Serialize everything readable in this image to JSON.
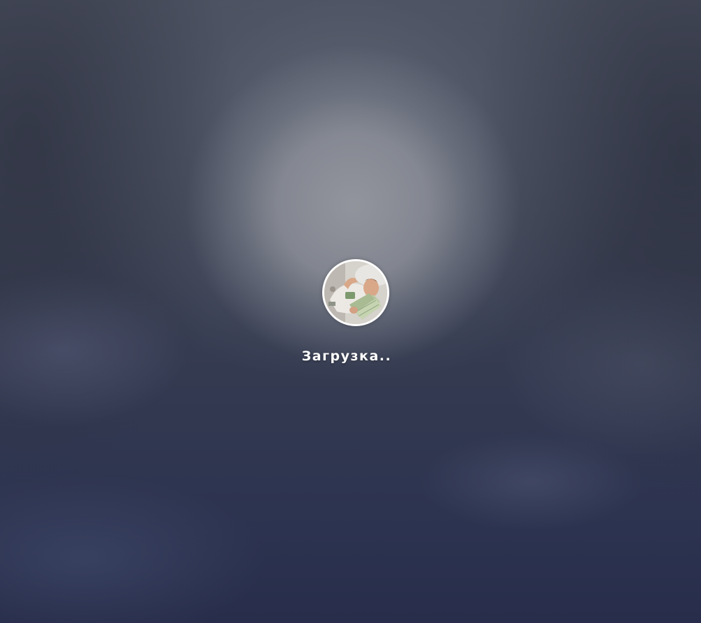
{
  "loading": {
    "text": "Загрузка.."
  },
  "avatar": {
    "icon": "user-photo",
    "alt": ""
  },
  "colors": {
    "background_top": "#4a4f5e",
    "background_bottom": "#272d4a",
    "glow": "#96989f",
    "text": "#ffffff",
    "avatar_border": "#ffffff"
  }
}
